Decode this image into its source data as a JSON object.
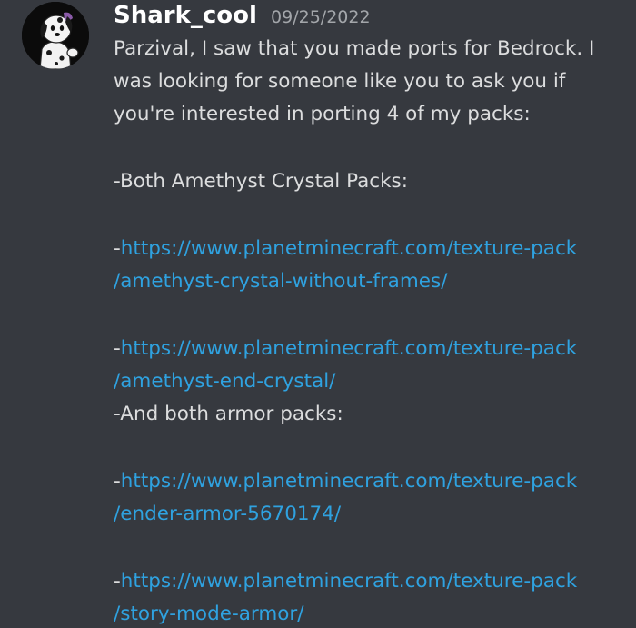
{
  "message": {
    "username": "Shark_cool",
    "timestamp": "09/25/2022",
    "intro_lines": [
      "Parzival, I saw that you made ports for Bedrock. I",
      "was looking for someone like you to ask you if",
      "you're interested in porting 4 of my packs:"
    ],
    "section1_heading": "-Both Amethyst Crystal Packs:",
    "section2_heading": "-And both armor packs:",
    "links": [
      {
        "prefix": "-",
        "line1": "https://www.planetminecraft.com/texture-pack",
        "line2": "/amethyst-crystal-without-frames/"
      },
      {
        "prefix": "-",
        "line1": "https://www.planetminecraft.com/texture-pack",
        "line2": "/amethyst-end-crystal/"
      },
      {
        "prefix": "-",
        "line1": "https://www.planetminecraft.com/texture-pack",
        "line2": "/ender-armor-5670174/"
      },
      {
        "prefix": "-",
        "line1": "https://www.planetminecraft.com/texture-pack",
        "line2": "/story-mode-armor/"
      }
    ]
  },
  "colors": {
    "background": "#36393f",
    "username": "#ffffff",
    "timestamp": "#a3a6aa",
    "text": "#dcddde",
    "link": "#2fa2e0"
  },
  "avatar": {
    "icon": "dog-avatar-icon"
  }
}
